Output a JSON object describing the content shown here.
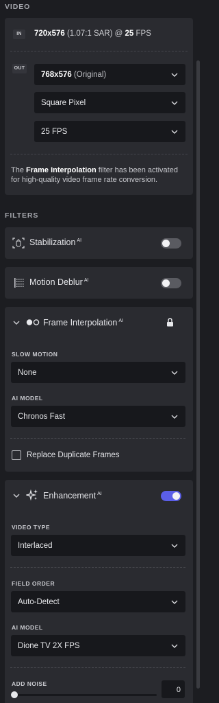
{
  "video": {
    "section_title": "VIDEO",
    "in_tag": "IN",
    "in_res": "720x576",
    "in_sar": " (1.07:1 SAR) @ ",
    "in_fps": "25",
    "in_fps_unit": " FPS",
    "out_tag": "OUT",
    "out_res": "768x576",
    "out_res_note": " (Original)",
    "pixel_aspect": "Square Pixel",
    "fps_select": "25 FPS",
    "note_prefix": "The ",
    "note_bold": "Frame Interpolation",
    "note_suffix": " filter has been activated for high-quality video frame rate conversion."
  },
  "filters": {
    "section_title": "FILTERS",
    "ai_sup": "AI",
    "stabilization": {
      "label": "Stabilization",
      "enabled": false
    },
    "motion_deblur": {
      "label": "Motion Deblur",
      "enabled": false
    },
    "frame_interpolation": {
      "label": "Frame Interpolation",
      "slow_motion_label": "SLOW MOTION",
      "slow_motion_value": "None",
      "ai_model_label": "AI MODEL",
      "ai_model_value": "Chronos Fast",
      "replace_dup_label": "Replace Duplicate Frames",
      "replace_dup_checked": false
    },
    "enhancement": {
      "label": "Enhancement",
      "enabled": true,
      "video_type_label": "VIDEO TYPE",
      "video_type_value": "Interlaced",
      "field_order_label": "FIELD ORDER",
      "field_order_value": "Auto-Detect",
      "ai_model_label": "AI MODEL",
      "ai_model_value": "Dione TV 2X FPS",
      "add_noise_label": "ADD NOISE",
      "add_noise_value": "0"
    }
  },
  "colors": {
    "accent": "#5b5fe8",
    "toggle_off": "#5a5b61"
  }
}
